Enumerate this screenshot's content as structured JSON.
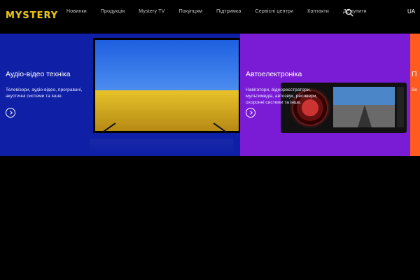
{
  "header": {
    "logo": "MYSTERY",
    "nav": [
      "Новинки",
      "Продукція",
      "Mystery TV",
      "Покупцям",
      "Підтримка",
      "Сервісні центри",
      "Контакти",
      "Де купити"
    ],
    "search_icon": "search-icon",
    "language": "UA"
  },
  "tiles": [
    {
      "title": "Аудіо-відео техніка",
      "description": "Телевізори, аудіо-відео, програвачі, акустичні системи та інше.",
      "accent": "#0f1fa6"
    },
    {
      "title": "Автоелектроніка",
      "description": "Навігатори, відеореєстратори, мультимедіа, автозвук, ресивери, охоронні системи та інше.",
      "accent": "#7a1bd6"
    },
    {
      "title": "П",
      "description": "Ве",
      "accent": "#ff5a1f"
    }
  ]
}
